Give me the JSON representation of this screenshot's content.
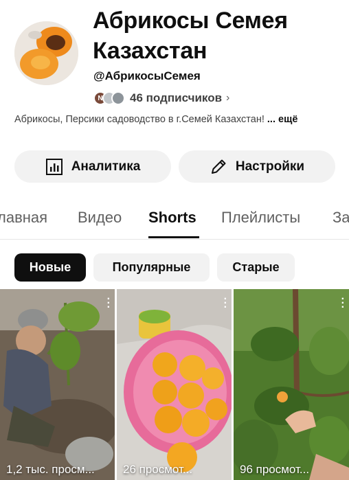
{
  "channel": {
    "name": "Абрикосы Семея Казахстан",
    "handle": "@АбрикосыСемея",
    "subscriber_avatar_letter": "N",
    "subscribers": "46 подписчиков",
    "description": "Абрикосы, Персики садоводство в г.Семей Казахстан!",
    "more": "... ещё"
  },
  "buttons": {
    "analytics": "Аналитика",
    "settings": "Настройки"
  },
  "tabs": [
    "лавная",
    "Видео",
    "Shorts",
    "Плейлисты",
    "За"
  ],
  "active_tab": "Shorts",
  "filters": [
    "Новые",
    "Популярные",
    "Старые"
  ],
  "active_filter": "Новые",
  "shorts": [
    {
      "views": "1,2 тыс. просм..."
    },
    {
      "views": "26 просмот..."
    },
    {
      "views": "96 просмот..."
    }
  ],
  "colors": {
    "chip_bg": "#f2f2f2",
    "active_chip": "#0f0f0f",
    "text_secondary": "#606060"
  }
}
